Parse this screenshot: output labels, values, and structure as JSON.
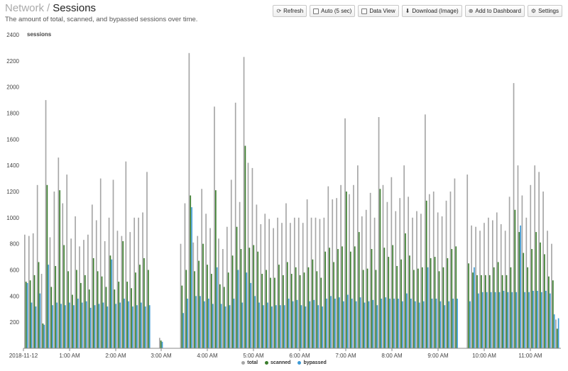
{
  "header": {
    "breadcrumb_parent": "Network",
    "breadcrumb_separator": "/",
    "title": "Sessions",
    "subtitle": "The amount of total, scanned, and bypassed sessions over time."
  },
  "toolbar": {
    "refresh_label": "Refresh",
    "auto_label": "Auto (5 sec)",
    "data_view_label": "Data View",
    "download_label": "Download (Image)",
    "add_dashboard_label": "Add to Dashboard",
    "settings_label": "Settings"
  },
  "colors": {
    "total": "#a6a6a6",
    "scanned": "#3a7d2c",
    "bypassed": "#3d9ad6",
    "axis": "#888888"
  },
  "chart_data": {
    "type": "bar",
    "ylabel": "sessions",
    "ylim": [
      0,
      2400
    ],
    "y_ticks": [
      200,
      400,
      600,
      800,
      1000,
      1200,
      1400,
      1600,
      1800,
      2000,
      2200,
      2400
    ],
    "x_tick_labels": [
      "2018-11-12",
      "1:00 AM",
      "2:00 AM",
      "3:00 AM",
      "4:00 AM",
      "5:00 AM",
      "6:00 AM",
      "7:00 AM",
      "8:00 AM",
      "9:00 AM",
      "10:00 AM",
      "11:00 AM"
    ],
    "legend_position": "bottom-center",
    "series": [
      {
        "name": "total",
        "values": [
          870,
          860,
          880,
          1250,
          570,
          1900,
          850,
          1200,
          1460,
          1110,
          1330,
          840,
          1010,
          780,
          830,
          870,
          1100,
          980,
          1300,
          820,
          1000,
          1290,
          900,
          860,
          1430,
          890,
          1000,
          1000,
          1040,
          1350,
          1150,
          790,
          80,
          30,
          350,
          620,
          800,
          800,
          1110,
          2260,
          810,
          860,
          1220,
          1030,
          920,
          1850,
          840,
          760,
          930,
          1290,
          1880,
          1120,
          2230,
          1420,
          1380,
          1100,
          950,
          1030,
          990,
          920,
          1000,
          960,
          1110,
          960,
          1000,
          1000,
          960,
          1140,
          1000,
          1000,
          990,
          1000,
          1240,
          1140,
          1150,
          1250,
          1760,
          1180,
          1250,
          1400,
          1010,
          1060,
          1190,
          1000,
          1770,
          1250,
          1120,
          1310,
          1050,
          1150,
          1400,
          1160,
          1000,
          1050,
          1030,
          1790,
          1180,
          1200,
          1040,
          1010,
          1130,
          1200,
          1300,
          1000,
          1350,
          1330,
          940,
          930,
          900,
          960,
          1000,
          980,
          1040,
          950,
          900,
          1160,
          2030,
          1400,
          1170,
          1000,
          1250,
          1400,
          1350,
          1200,
          900,
          800,
          220
        ],
        "missing_gaps": "bars absent around 3:00–3:40 AM and around 9:45–10:00 AM"
      },
      {
        "name": "scanned",
        "values": [
          510,
          520,
          560,
          660,
          190,
          1250,
          470,
          630,
          1210,
          790,
          590,
          410,
          600,
          500,
          560,
          450,
          690,
          590,
          550,
          470,
          710,
          450,
          510,
          820,
          510,
          460,
          580,
          640,
          690,
          600,
          480,
          520,
          60,
          25,
          250,
          420,
          470,
          480,
          600,
          1170,
          590,
          670,
          800,
          640,
          570,
          1210,
          490,
          470,
          580,
          710,
          930,
          760,
          1550,
          770,
          790,
          740,
          570,
          600,
          540,
          540,
          640,
          560,
          660,
          570,
          620,
          560,
          580,
          620,
          680,
          590,
          540,
          740,
          770,
          660,
          760,
          780,
          1200,
          740,
          780,
          890,
          600,
          610,
          760,
          600,
          1220,
          770,
          700,
          790,
          630,
          680,
          880,
          710,
          600,
          610,
          620,
          1130,
          690,
          700,
          590,
          620,
          690,
          760,
          780,
          620,
          780,
          650,
          580,
          560,
          560,
          560,
          560,
          620,
          660,
          560,
          560,
          620,
          1060,
          890,
          730,
          620,
          760,
          890,
          810,
          720,
          550,
          520,
          150
        ],
        "values_note": "approximate reading from bar heights"
      },
      {
        "name": "bypassed",
        "values": [
          500,
          350,
          320,
          420,
          180,
          640,
          330,
          350,
          340,
          330,
          350,
          330,
          380,
          350,
          360,
          310,
          330,
          340,
          350,
          320,
          680,
          340,
          350,
          380,
          360,
          320,
          330,
          350,
          320,
          330,
          330,
          200,
          50,
          20,
          340,
          250,
          260,
          270,
          380,
          1080,
          400,
          400,
          360,
          380,
          340,
          620,
          340,
          320,
          330,
          380,
          600,
          350,
          580,
          500,
          400,
          350,
          330,
          350,
          320,
          330,
          330,
          330,
          380,
          360,
          370,
          330,
          320,
          360,
          370,
          330,
          320,
          380,
          400,
          380,
          390,
          360,
          410,
          380,
          360,
          390,
          350,
          360,
          370,
          330,
          380,
          390,
          380,
          380,
          380,
          360,
          420,
          380,
          360,
          350,
          360,
          620,
          380,
          380,
          360,
          330,
          360,
          380,
          380,
          350,
          380,
          360,
          620,
          420,
          430,
          430,
          430,
          430,
          430,
          440,
          430,
          430,
          430,
          940,
          430,
          430,
          440,
          440,
          430,
          440,
          420,
          260,
          230,
          80
        ]
      }
    ]
  }
}
